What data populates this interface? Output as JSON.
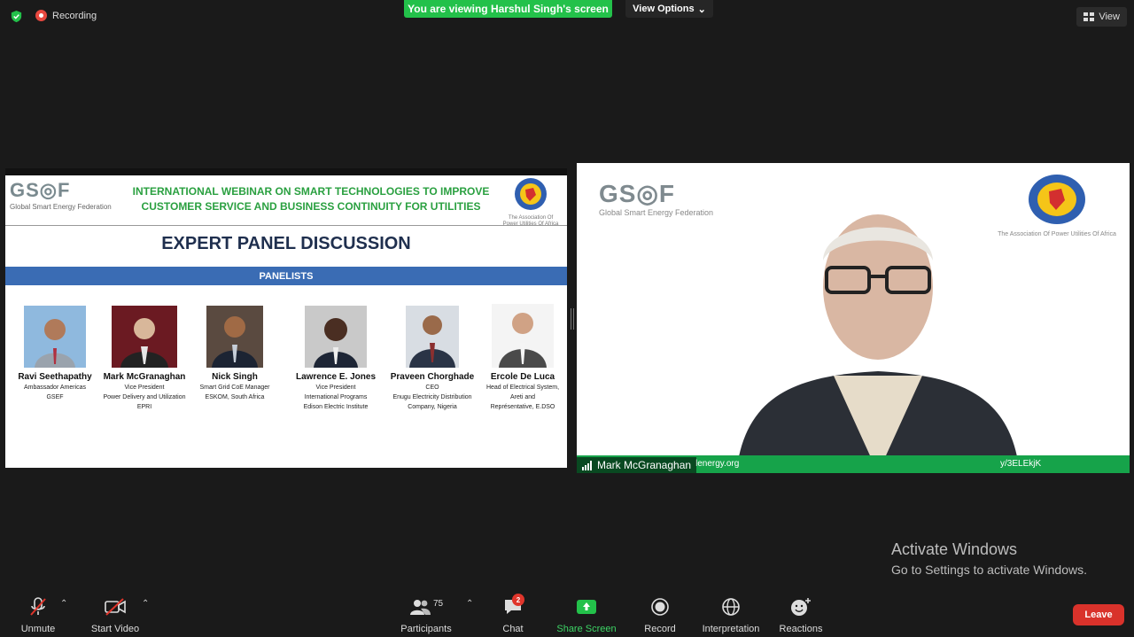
{
  "top": {
    "recording_label": "Recording",
    "viewing_banner": "You are viewing Harshul Singh's screen",
    "view_options_label": "View Options",
    "view_label": "View"
  },
  "share": {
    "logo_text": "GS◎F",
    "logo_caption": "Global Smart Energy Federation",
    "title_line1": "INTERNATIONAL WEBINAR ON SMART TECHNOLOGIES TO IMPROVE",
    "title_line2": "CUSTOMER SERVICE AND BUSINESS CONTINUITY FOR UTILITIES",
    "apua_caption_line1": "The Association Of",
    "apua_caption_line2": "Power Utilities Of Africa",
    "heading": "EXPERT PANEL DISCUSSION",
    "panel_band": "PANELISTS",
    "panelists": [
      {
        "name": "Ravi Seethapathy",
        "role1": "Ambassador  Americas",
        "role2": "GSEF",
        "role3": ""
      },
      {
        "name": "Mark McGranaghan",
        "role1": "Vice President",
        "role2": "Power Delivery and Utilization",
        "role3": "EPRI"
      },
      {
        "name": "Nick Singh",
        "role1": "Smart Grid CoE Manager",
        "role2": "ESKOM, South Africa",
        "role3": ""
      },
      {
        "name": "Lawrence E. Jones",
        "role1": "Vice President",
        "role2": "International Programs",
        "role3": "Edison Electric Institute"
      },
      {
        "name": "Praveen Chorghade",
        "role1": "CEO",
        "role2": "Enugu Electricity Distribution",
        "role3": "Company, Nigeria"
      },
      {
        "name": "Ercole De Luca",
        "role1": "Head of Electrical System,",
        "role2": "Areti and",
        "role3": "Représentative, E.DSO"
      }
    ]
  },
  "speaker": {
    "logo_text": "GS◎F",
    "logo_caption": "Global Smart Energy Federation",
    "apua_caption": "The Association Of Power Utilities Of Africa",
    "band_left": "lenergy.org",
    "band_right": "y/3ELEkjK",
    "name": "Mark McGranaghan"
  },
  "activate": {
    "title": "Activate Windows",
    "subtitle": "Go to Settings to activate Windows."
  },
  "toolbar": {
    "unmute": "Unmute",
    "start_video": "Start Video",
    "participants": "Participants",
    "participants_count": "75",
    "chat": "Chat",
    "chat_badge": "2",
    "share_screen": "Share Screen",
    "record": "Record",
    "interpretation": "Interpretation",
    "reactions": "Reactions",
    "leave": "Leave"
  }
}
